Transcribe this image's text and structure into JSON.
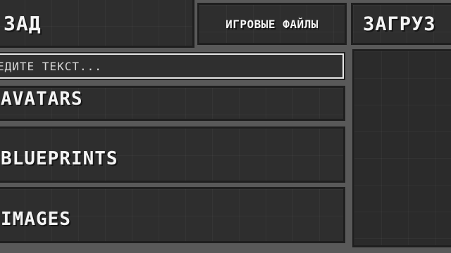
{
  "header": {
    "back_label": "ЗАД",
    "game_files_label": "ИГРОВЫЕ ФАЙЛЫ",
    "download_label": "ЗАГРУЗ"
  },
  "search": {
    "placeholder": "ЕДИТЕ ТЕКСТ..."
  },
  "list": {
    "items": [
      {
        "label": "AVATARS"
      },
      {
        "label": "BLUEPRINTS"
      },
      {
        "label": "IMAGES"
      }
    ]
  },
  "colors": {
    "background": "#595959",
    "panel": "#2e2e2e",
    "panel_border": "#1f1f1f",
    "text": "#ffffff",
    "search_border": "#e6e6e6"
  }
}
